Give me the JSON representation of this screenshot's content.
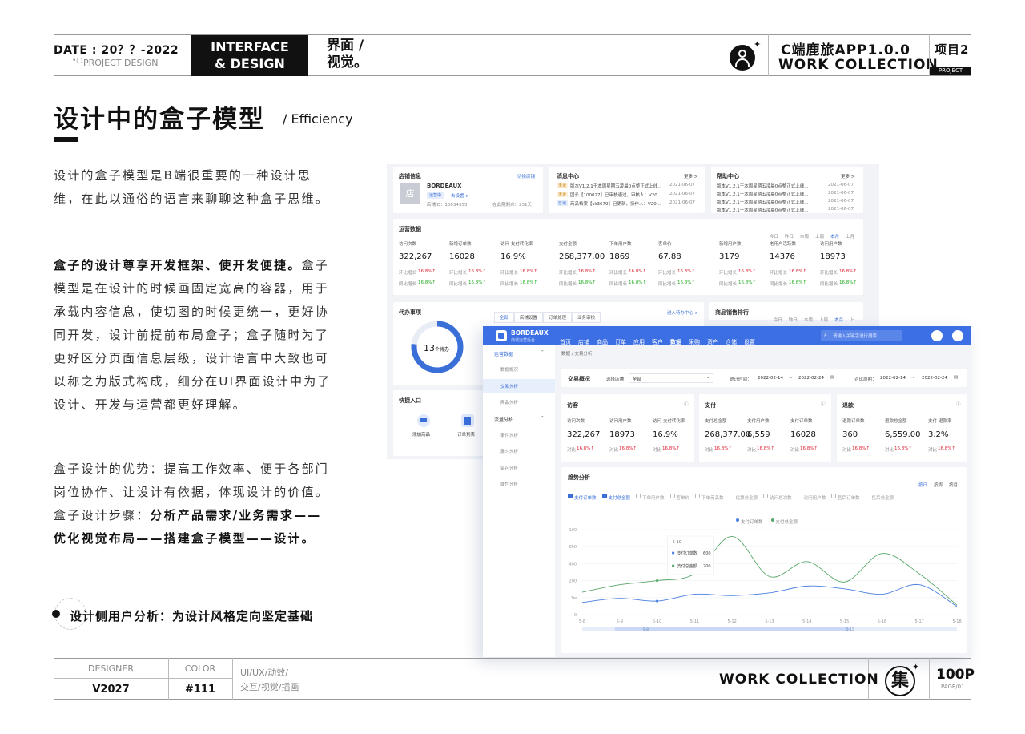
{
  "header": {
    "date": "DATE : 20？？-2022",
    "project_design": "PROJECT DESIGN",
    "interface_line1": "INTERFACE",
    "interface_line2": "& DESIGN",
    "visual_line1": "界面 /",
    "visual_line2": "视觉。",
    "app_name": "C端鹿旅APP1.0.0",
    "work_collection": "WORK  COLLECTION",
    "project_num": "项目2",
    "project_label": "PROJECT"
  },
  "title": {
    "main": "设计中的盒子模型",
    "sub": "/ Efficiency"
  },
  "body": {
    "p1": "设计的盒子模型是B端很重要的一种设计思维，在此以通俗的语言来聊聊这种盒子思维。",
    "p2_bold": "盒子的设计尊享开发框架、使开发便捷。",
    "p2_rest": "盒子模型是在设计的时候画固定宽高的容器，用于承载内容信息，使切图的时候更统一，更好协同开发，设计前提前布局盒子；盒子随时为了更好区分页面信息层级，设计语言中大致也可以称之为版式构成，细分在UI界面设计中为了设计、开发与运营都更好理解。",
    "p3_plain": "盒子设计的优势：提高工作效率、便于各部门岗位协作、让设计有依据，体现设计的价值。盒子设计步骤：",
    "p3_bold": "分析产品需求/业务需求——优化视觉布局——搭建盒子模型——设计。",
    "bullet": "设计侧用户分析：为设计风格定向坚定基础"
  },
  "footer": {
    "designer_label": "DESIGNER",
    "designer_value": "V2027",
    "color_label": "COLOR",
    "color_value": "#111",
    "tags_line1": "UI/UX/动效/",
    "tags_line2": "交互/视觉/插画",
    "work_collection": "WORK  COLLECTION",
    "ji": "集",
    "page_num": "100P",
    "page_sub": "PAGE/01"
  },
  "mock1": {
    "shop_title": "店铺信息",
    "switch_shop": "切换店铺",
    "shop_icon": "店",
    "shop_name": "BORDEAUX",
    "shop_tag": "运营中",
    "shop_setting": "去设置 >",
    "shop_id": "店铺ID：10034353",
    "shop_date": "在此期剩余：231天",
    "msg_title": "消息中心",
    "more": "更多 >",
    "messages": [
      {
        "tag": "未读",
        "text": "版本V1.2.1于本周星期五凌晨0点整正式上线...",
        "date": "2021-06-07"
      },
      {
        "tag": "未读",
        "text": "团长【100027】已审核通过，审核人：V20...",
        "date": "2021-06-07"
      },
      {
        "tag": "已读",
        "text": "商品档案【sk3679】已更新，操作人：V20...",
        "date": "2021-06-07"
      }
    ],
    "help_title": "帮助中心",
    "help": [
      {
        "text": "版本V1.2.1于本周星期五凌晨0点整正式上线...",
        "date": "2021-06-07"
      },
      {
        "text": "版本V1.2.1于本周星期五凌晨0点整正式上线...",
        "date": "2021-06-07"
      },
      {
        "text": "版本V1.2.1于本周星期五凌晨0点整正式上线...",
        "date": "2021-06-07"
      },
      {
        "text": "版本V1.2.1于本周星期五凌晨0点整正式上线...",
        "date": "2021-06-07"
      }
    ],
    "ops_title": "运营数据",
    "ops_periods": [
      "今日",
      "昨日",
      "本周",
      "上周",
      "本月",
      "上月"
    ],
    "ops_metrics": [
      {
        "label": "访问次数",
        "value": "322,267"
      },
      {
        "label": "新增订单数",
        "value": "16028"
      },
      {
        "label": "访问-支付转化率",
        "value": "16.9%"
      },
      {
        "label": "支付金额",
        "value": "268,377.00"
      },
      {
        "label": "下单用户数",
        "value": "1869"
      },
      {
        "label": "客单价",
        "value": "67.88"
      },
      {
        "label": "新增用户数",
        "value": "3179"
      },
      {
        "label": "老用户活跃数",
        "value": "14376"
      },
      {
        "label": "访问用户数",
        "value": "18973"
      }
    ],
    "ring_label": "环比增长",
    "yoy_label": "同比增长",
    "pct": "16.8%",
    "todo_title": "代办事项",
    "todo_tabs": [
      "全部",
      "店铺设置",
      "订单处理",
      "业务审核"
    ],
    "todo_link": "进入待办中心 >",
    "todo_count": "13",
    "todo_unit": "个待办",
    "quick_title": "快捷入口",
    "quick_items": [
      "添加商品",
      "订单列表"
    ],
    "rank_title": "商品销售排行"
  },
  "mock2": {
    "brand": "BORDEAUX",
    "brand_sub": "商城运营后台",
    "nav": [
      "首页",
      "店铺",
      "商品",
      "订单",
      "应用",
      "客户",
      "数据",
      "采购",
      "资产",
      "仓储",
      "设置"
    ],
    "search_placeholder": "请输入关键字进行搜索",
    "side_groups": [
      {
        "title": "运营数据",
        "items": [
          "数据概况",
          "交易分析",
          "商品分析"
        ]
      },
      {
        "title": "流量分析",
        "items": [
          "事件分析",
          "漏斗分析",
          "留存分析",
          "属性分析"
        ]
      }
    ],
    "breadcrumb": "数据  /  交易分析",
    "filter_title": "交易概况",
    "filter_shop_label": "选择店铺：",
    "filter_shop_value": "全部",
    "filter_time_label": "统计时间：",
    "filter_compare_label": "对比周期：",
    "date_from": "2022-02-14",
    "date_to": "2022-02-24",
    "boxes": [
      {
        "title": "访客",
        "metrics": [
          {
            "label": "访问次数",
            "value": "322,267"
          },
          {
            "label": "访问用户数",
            "value": "18973"
          },
          {
            "label": "访问-支付转化率",
            "value": "16.9%"
          }
        ]
      },
      {
        "title": "支付",
        "metrics": [
          {
            "label": "支付总金额",
            "value": "268,377.00"
          },
          {
            "label": "支付用户数",
            "value": "6,559"
          },
          {
            "label": "支付订单数",
            "value": "16028"
          }
        ]
      },
      {
        "title": "退款",
        "metrics": [
          {
            "label": "退款订单数",
            "value": "360"
          },
          {
            "label": "退款总金额",
            "value": "6,559.00"
          },
          {
            "label": "支付-退款率",
            "value": "3.2%"
          }
        ]
      }
    ],
    "compare_label": "对比",
    "pct": "16.8%",
    "trend_title": "趋势分析",
    "trend_periods": [
      "按日",
      "按周",
      "按月"
    ],
    "checkboxes": [
      {
        "label": "支付订单数",
        "checked": true
      },
      {
        "label": "支付总金额",
        "checked": true
      },
      {
        "label": "下单用户数",
        "checked": false
      },
      {
        "label": "客单价",
        "checked": false
      },
      {
        "label": "下单商品数",
        "checked": false
      },
      {
        "label": "优惠总金额",
        "checked": false
      },
      {
        "label": "访问总次数",
        "checked": false
      },
      {
        "label": "访问用户数",
        "checked": false
      },
      {
        "label": "售后订单数",
        "checked": false
      },
      {
        "label": "售后总金额",
        "checked": false
      }
    ],
    "tooltip": {
      "date": "5-10",
      "rows": [
        {
          "label": "支付订单数",
          "value": "600"
        },
        {
          "label": "支付总金额",
          "value": "200"
        }
      ]
    },
    "range_from": "5-8",
    "range_to": "5-15"
  },
  "chart_data": {
    "type": "line",
    "x": [
      "5-8",
      "5-9",
      "5-10",
      "5-11",
      "5-12",
      "5-13",
      "5-14",
      "5-15",
      "5-16",
      "5-17",
      "5-18"
    ],
    "y_ticks": [
      "0",
      "1w",
      "200",
      "400",
      "600",
      "100"
    ],
    "series": [
      {
        "name": "支付订单数",
        "color": "#4a7fe0",
        "values": [
          180,
          240,
          200,
          300,
          280,
          320,
          420,
          380,
          300,
          440,
          120
        ]
      },
      {
        "name": "支付总金额",
        "color": "#5aa86a",
        "values": [
          330,
          440,
          500,
          600,
          1150,
          560,
          780,
          480,
          900,
          600,
          140
        ]
      }
    ],
    "ylim": [
      0,
      1250
    ]
  }
}
